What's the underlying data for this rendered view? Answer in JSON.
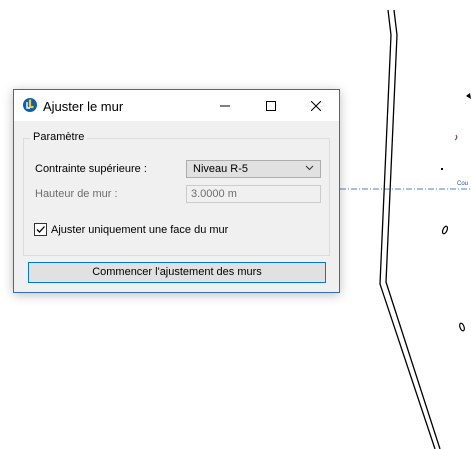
{
  "dialog": {
    "title": "Ajuster le mur",
    "controls": {
      "minimize": "—",
      "close": "✕"
    }
  },
  "params": {
    "legend": "Paramètre",
    "constraint_label": "Contrainte supérieure :",
    "constraint_value": "Niveau R-5",
    "height_label": "Hauteur de mur :",
    "height_value": "3.0000 m"
  },
  "option": {
    "label": "Ajuster uniquement une face du mur",
    "checked": true
  },
  "action": {
    "label": "Commencer l'ajustement des murs"
  },
  "background": {
    "annotation": "Cou"
  },
  "colors": {
    "accent": "#0078d7",
    "dialog_border": "#2f6fb0",
    "dialog_bg": "#f0f0f0",
    "drawing_line": "#000000",
    "gridline": "#4a7fd0"
  }
}
